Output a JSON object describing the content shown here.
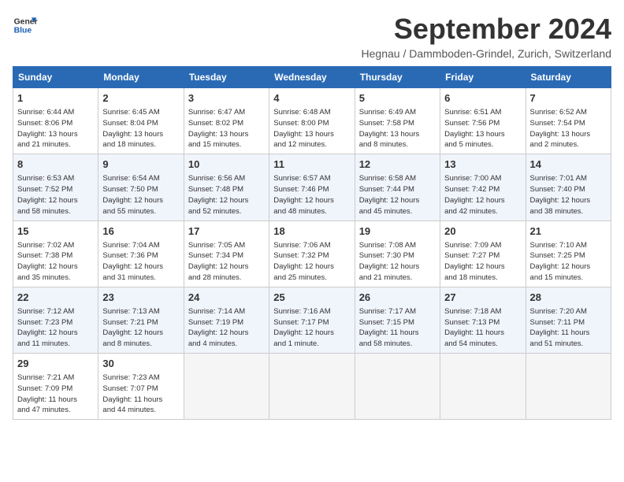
{
  "logo": {
    "line1": "General",
    "line2": "Blue"
  },
  "title": "September 2024",
  "subtitle": "Hegnau / Dammboden-Grindel, Zurich, Switzerland",
  "weekdays": [
    "Sunday",
    "Monday",
    "Tuesday",
    "Wednesday",
    "Thursday",
    "Friday",
    "Saturday"
  ],
  "weeks": [
    [
      {
        "day": "1",
        "info": "Sunrise: 6:44 AM\nSunset: 8:06 PM\nDaylight: 13 hours\nand 21 minutes."
      },
      {
        "day": "2",
        "info": "Sunrise: 6:45 AM\nSunset: 8:04 PM\nDaylight: 13 hours\nand 18 minutes."
      },
      {
        "day": "3",
        "info": "Sunrise: 6:47 AM\nSunset: 8:02 PM\nDaylight: 13 hours\nand 15 minutes."
      },
      {
        "day": "4",
        "info": "Sunrise: 6:48 AM\nSunset: 8:00 PM\nDaylight: 13 hours\nand 12 minutes."
      },
      {
        "day": "5",
        "info": "Sunrise: 6:49 AM\nSunset: 7:58 PM\nDaylight: 13 hours\nand 8 minutes."
      },
      {
        "day": "6",
        "info": "Sunrise: 6:51 AM\nSunset: 7:56 PM\nDaylight: 13 hours\nand 5 minutes."
      },
      {
        "day": "7",
        "info": "Sunrise: 6:52 AM\nSunset: 7:54 PM\nDaylight: 13 hours\nand 2 minutes."
      }
    ],
    [
      {
        "day": "8",
        "info": "Sunrise: 6:53 AM\nSunset: 7:52 PM\nDaylight: 12 hours\nand 58 minutes."
      },
      {
        "day": "9",
        "info": "Sunrise: 6:54 AM\nSunset: 7:50 PM\nDaylight: 12 hours\nand 55 minutes."
      },
      {
        "day": "10",
        "info": "Sunrise: 6:56 AM\nSunset: 7:48 PM\nDaylight: 12 hours\nand 52 minutes."
      },
      {
        "day": "11",
        "info": "Sunrise: 6:57 AM\nSunset: 7:46 PM\nDaylight: 12 hours\nand 48 minutes."
      },
      {
        "day": "12",
        "info": "Sunrise: 6:58 AM\nSunset: 7:44 PM\nDaylight: 12 hours\nand 45 minutes."
      },
      {
        "day": "13",
        "info": "Sunrise: 7:00 AM\nSunset: 7:42 PM\nDaylight: 12 hours\nand 42 minutes."
      },
      {
        "day": "14",
        "info": "Sunrise: 7:01 AM\nSunset: 7:40 PM\nDaylight: 12 hours\nand 38 minutes."
      }
    ],
    [
      {
        "day": "15",
        "info": "Sunrise: 7:02 AM\nSunset: 7:38 PM\nDaylight: 12 hours\nand 35 minutes."
      },
      {
        "day": "16",
        "info": "Sunrise: 7:04 AM\nSunset: 7:36 PM\nDaylight: 12 hours\nand 31 minutes."
      },
      {
        "day": "17",
        "info": "Sunrise: 7:05 AM\nSunset: 7:34 PM\nDaylight: 12 hours\nand 28 minutes."
      },
      {
        "day": "18",
        "info": "Sunrise: 7:06 AM\nSunset: 7:32 PM\nDaylight: 12 hours\nand 25 minutes."
      },
      {
        "day": "19",
        "info": "Sunrise: 7:08 AM\nSunset: 7:30 PM\nDaylight: 12 hours\nand 21 minutes."
      },
      {
        "day": "20",
        "info": "Sunrise: 7:09 AM\nSunset: 7:27 PM\nDaylight: 12 hours\nand 18 minutes."
      },
      {
        "day": "21",
        "info": "Sunrise: 7:10 AM\nSunset: 7:25 PM\nDaylight: 12 hours\nand 15 minutes."
      }
    ],
    [
      {
        "day": "22",
        "info": "Sunrise: 7:12 AM\nSunset: 7:23 PM\nDaylight: 12 hours\nand 11 minutes."
      },
      {
        "day": "23",
        "info": "Sunrise: 7:13 AM\nSunset: 7:21 PM\nDaylight: 12 hours\nand 8 minutes."
      },
      {
        "day": "24",
        "info": "Sunrise: 7:14 AM\nSunset: 7:19 PM\nDaylight: 12 hours\nand 4 minutes."
      },
      {
        "day": "25",
        "info": "Sunrise: 7:16 AM\nSunset: 7:17 PM\nDaylight: 12 hours\nand 1 minute."
      },
      {
        "day": "26",
        "info": "Sunrise: 7:17 AM\nSunset: 7:15 PM\nDaylight: 11 hours\nand 58 minutes."
      },
      {
        "day": "27",
        "info": "Sunrise: 7:18 AM\nSunset: 7:13 PM\nDaylight: 11 hours\nand 54 minutes."
      },
      {
        "day": "28",
        "info": "Sunrise: 7:20 AM\nSunset: 7:11 PM\nDaylight: 11 hours\nand 51 minutes."
      }
    ],
    [
      {
        "day": "29",
        "info": "Sunrise: 7:21 AM\nSunset: 7:09 PM\nDaylight: 11 hours\nand 47 minutes."
      },
      {
        "day": "30",
        "info": "Sunrise: 7:23 AM\nSunset: 7:07 PM\nDaylight: 11 hours\nand 44 minutes."
      },
      {
        "day": "",
        "info": ""
      },
      {
        "day": "",
        "info": ""
      },
      {
        "day": "",
        "info": ""
      },
      {
        "day": "",
        "info": ""
      },
      {
        "day": "",
        "info": ""
      }
    ]
  ]
}
